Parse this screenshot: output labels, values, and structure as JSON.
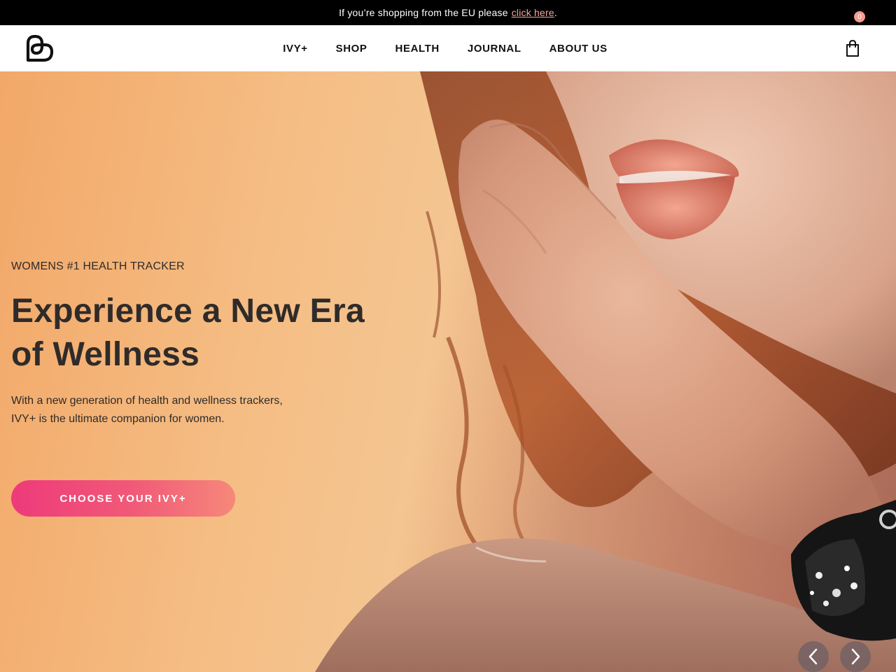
{
  "announcement": {
    "text": "If you’re shopping from the EU please",
    "link_label": "click here",
    "suffix": "."
  },
  "header": {
    "logo_icon": "brand-heart-logo-icon",
    "nav": [
      {
        "label": "IVY+"
      },
      {
        "label": "SHOP"
      },
      {
        "label": "HEALTH"
      },
      {
        "label": "JOURNAL"
      },
      {
        "label": "ABOUT US"
      }
    ],
    "cart": {
      "icon": "shopping-bag-icon",
      "count": "0"
    }
  },
  "hero": {
    "eyebrow": "WOMENS #1 HEALTH TRACKER",
    "headline_part1": "Experience a ",
    "headline_bold": "New Era",
    "headline_part2": "of Wellness",
    "subtext_line1": "With a new generation of health and wellness trackers,",
    "subtext_line2": "IVY+ is the ultimate companion for women.",
    "cta_label": "CHOOSE YOUR IVY+",
    "prev_icon": "chevron-left-icon",
    "next_icon": "chevron-right-icon"
  },
  "colors": {
    "announcement_bg": "#000000",
    "link": "#f0a6a0",
    "cart_badge": "#f49c8c",
    "cta_gradient_start": "#ee3a7a",
    "cta_gradient_end": "#f6887a",
    "hero_bg": "#f4c591"
  }
}
